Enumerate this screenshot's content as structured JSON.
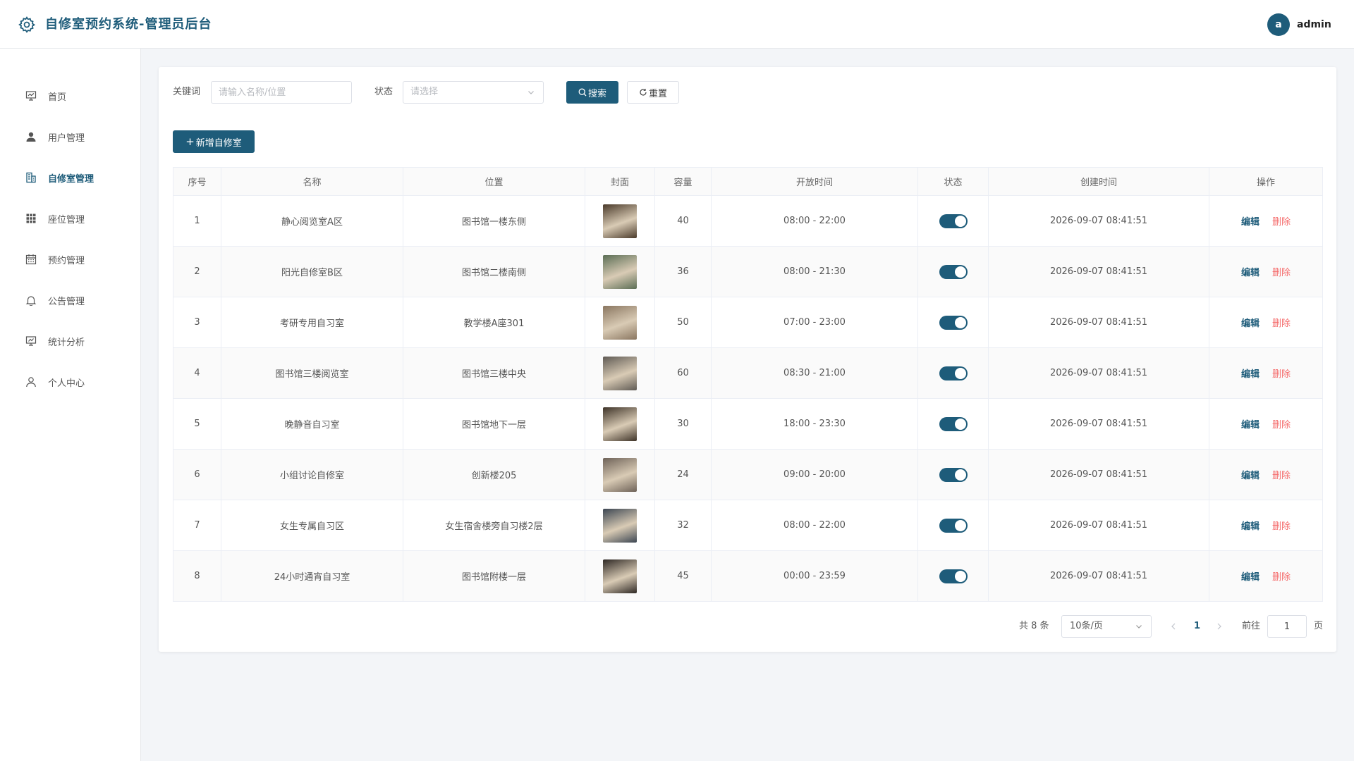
{
  "header": {
    "title": "自修室预约系统-管理员后台",
    "avatar_letter": "a",
    "username": "admin"
  },
  "sidebar": {
    "items": [
      {
        "label": "首页",
        "icon": "monitor-icon"
      },
      {
        "label": "用户管理",
        "icon": "user-icon"
      },
      {
        "label": "自修室管理",
        "icon": "building-icon",
        "active": true
      },
      {
        "label": "座位管理",
        "icon": "grid-icon"
      },
      {
        "label": "预约管理",
        "icon": "calendar-icon"
      },
      {
        "label": "公告管理",
        "icon": "bell-icon"
      },
      {
        "label": "统计分析",
        "icon": "chart-icon"
      },
      {
        "label": "个人中心",
        "icon": "person-icon"
      }
    ]
  },
  "filters": {
    "keyword_label": "关键词",
    "keyword_placeholder": "请输入名称/位置",
    "status_label": "状态",
    "status_placeholder": "请选择",
    "search_label": "搜索",
    "reset_label": "重置"
  },
  "actions": {
    "add_label": "新增自修室"
  },
  "table": {
    "columns": [
      "序号",
      "名称",
      "位置",
      "封面",
      "容量",
      "开放时间",
      "状态",
      "创建时间",
      "操作"
    ],
    "edit_label": "编辑",
    "delete_label": "删除",
    "rows": [
      {
        "no": "1",
        "name": "静心阅览室A区",
        "location": "图书馆一楼东侧",
        "capacity": "40",
        "hours": "08:00 - 22:00",
        "enabled": true,
        "created": "2026-09-07 08:41:51",
        "cover_color": "#4a3a2a"
      },
      {
        "no": "2",
        "name": "阳光自修室B区",
        "location": "图书馆二楼南侧",
        "capacity": "36",
        "hours": "08:00 - 21:30",
        "enabled": true,
        "created": "2026-09-07 08:41:51",
        "cover_color": "#5b6e55"
      },
      {
        "no": "3",
        "name": "考研专用自习室",
        "location": "教学楼A座301",
        "capacity": "50",
        "hours": "07:00 - 23:00",
        "enabled": true,
        "created": "2026-09-07 08:41:51",
        "cover_color": "#8a7660"
      },
      {
        "no": "4",
        "name": "图书馆三楼阅览室",
        "location": "图书馆三楼中央",
        "capacity": "60",
        "hours": "08:30 - 21:00",
        "enabled": true,
        "created": "2026-09-07 08:41:51",
        "cover_color": "#5f5a54"
      },
      {
        "no": "5",
        "name": "晚静音自习室",
        "location": "图书馆地下一层",
        "capacity": "30",
        "hours": "18:00 - 23:30",
        "enabled": true,
        "created": "2026-09-07 08:41:51",
        "cover_color": "#3e3328"
      },
      {
        "no": "6",
        "name": "小组讨论自修室",
        "location": "创新楼205",
        "capacity": "24",
        "hours": "09:00 - 20:00",
        "enabled": true,
        "created": "2026-09-07 08:41:51",
        "cover_color": "#6e6258"
      },
      {
        "no": "7",
        "name": "女生专属自习区",
        "location": "女生宿舍楼旁自习楼2层",
        "capacity": "32",
        "hours": "08:00 - 22:00",
        "enabled": true,
        "created": "2026-09-07 08:41:51",
        "cover_color": "#3c4652"
      },
      {
        "no": "8",
        "name": "24小时通宵自习室",
        "location": "图书馆附楼一层",
        "capacity": "45",
        "hours": "00:00 - 23:59",
        "enabled": true,
        "created": "2026-09-07 08:41:51",
        "cover_color": "#2e2824"
      }
    ]
  },
  "pagination": {
    "total_text": "共 8 条",
    "page_size": "10条/页",
    "current_page": "1",
    "goto_label": "前往",
    "goto_value": "1",
    "page_suffix": "页"
  },
  "colors": {
    "primary": "#1e5c7a",
    "danger": "#f56c6c"
  }
}
